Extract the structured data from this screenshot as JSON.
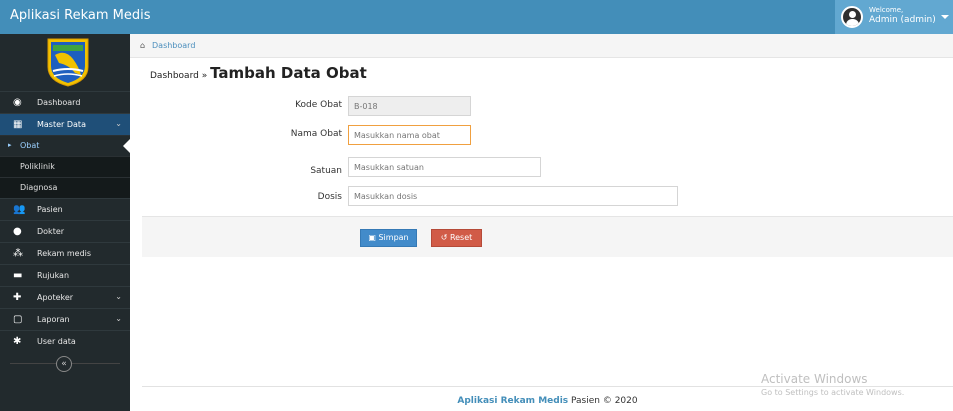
{
  "app": {
    "title": "Aplikasi Rekam Medis"
  },
  "user": {
    "welcome": "Welcome,",
    "name": "Admin (admin)"
  },
  "sidebar": {
    "items": [
      {
        "label": "Dashboard",
        "icon": "dashboard-icon"
      },
      {
        "label": "Master Data",
        "icon": "grid-icon"
      },
      {
        "label": "Pasien",
        "icon": "users-icon"
      },
      {
        "label": "Dokter",
        "icon": "user-icon"
      },
      {
        "label": "Rekam medis",
        "icon": "group-icon"
      },
      {
        "label": "Rujukan",
        "icon": "car-icon"
      },
      {
        "label": "Apoteker",
        "icon": "user-md-icon"
      },
      {
        "label": "Laporan",
        "icon": "file-icon"
      },
      {
        "label": "User data",
        "icon": "gear-icon"
      }
    ],
    "submenu": [
      {
        "label": "Obat"
      },
      {
        "label": "Poliklinik"
      },
      {
        "label": "Diagnosa"
      }
    ]
  },
  "breadcrumb": {
    "home": "Dashboard"
  },
  "header": {
    "small": "Dashboard »",
    "title": "Tambah Data Obat"
  },
  "form": {
    "kode": {
      "label": "Kode Obat",
      "value": "B-018"
    },
    "nama": {
      "label": "Nama Obat",
      "placeholder": "Masukkan nama obat"
    },
    "satuan": {
      "label": "Satuan",
      "placeholder": "Masukkan satuan"
    },
    "dosis": {
      "label": "Dosis",
      "placeholder": "Masukkan dosis"
    },
    "save": "Simpan",
    "reset": "Reset"
  },
  "footer": {
    "app": "Aplikasi Rekam Medis",
    "rest": " Pasien © 2020"
  },
  "watermark": {
    "line1": "Activate Windows",
    "line2": "Go to Settings to activate Windows."
  },
  "colors": {
    "navbar": "#438eb9",
    "sidebar": "#222a2d",
    "save": "#428bca",
    "reset": "#d15b47"
  }
}
